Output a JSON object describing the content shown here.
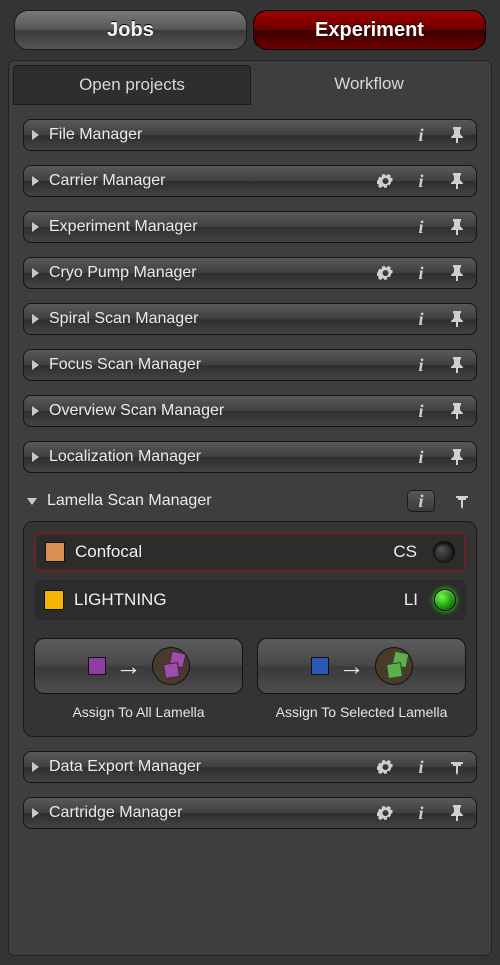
{
  "top_tabs": {
    "jobs": "Jobs",
    "experiment": "Experiment",
    "active": "experiment"
  },
  "sub_tabs": {
    "open_projects": "Open projects",
    "workflow": "Workflow",
    "active": "open_projects"
  },
  "sections": {
    "file_manager": {
      "title": "File Manager",
      "gear": false,
      "pin": "pin",
      "expanded": false
    },
    "carrier_manager": {
      "title": "Carrier Manager",
      "gear": true,
      "pin": "pin",
      "expanded": false
    },
    "experiment_manager": {
      "title": "Experiment Manager",
      "gear": false,
      "pin": "pin",
      "expanded": false
    },
    "cryo_pump_manager": {
      "title": "Cryo Pump Manager",
      "gear": true,
      "pin": "pin",
      "expanded": false
    },
    "spiral_scan_manager": {
      "title": "Spiral Scan Manager",
      "gear": false,
      "pin": "pin",
      "expanded": false
    },
    "focus_scan_manager": {
      "title": "Focus Scan Manager",
      "gear": false,
      "pin": "pin",
      "expanded": false
    },
    "overview_scan_manager": {
      "title": "Overview Scan Manager",
      "gear": false,
      "pin": "pin",
      "expanded": false
    },
    "localization_manager": {
      "title": "Localization Manager",
      "gear": false,
      "pin": "pin",
      "expanded": false
    },
    "lamella_scan_manager": {
      "title": "Lamella Scan Manager",
      "gear": false,
      "pin": "pinned",
      "expanded": true,
      "info_badge": true
    },
    "data_export_manager": {
      "title": "Data Export Manager",
      "gear": true,
      "pin": "pinned",
      "expanded": false
    },
    "cartridge_manager": {
      "title": "Cartridge Manager",
      "gear": true,
      "pin": "pin",
      "expanded": false
    }
  },
  "lamella": {
    "modes": {
      "confocal": {
        "label": "Confocal",
        "code": "CS",
        "swatch": "#d98f55",
        "on": false,
        "selected": true
      },
      "lightning": {
        "label": "LIGHTNING",
        "code": "LI",
        "swatch": "#f5b400",
        "on": true,
        "selected": false
      }
    },
    "assign_all": {
      "label": "Assign To All Lamella",
      "sq_color": "#8d3fa1"
    },
    "assign_selected": {
      "label": "Assign To Selected Lamella",
      "sq_color": "#2f55b5"
    }
  }
}
